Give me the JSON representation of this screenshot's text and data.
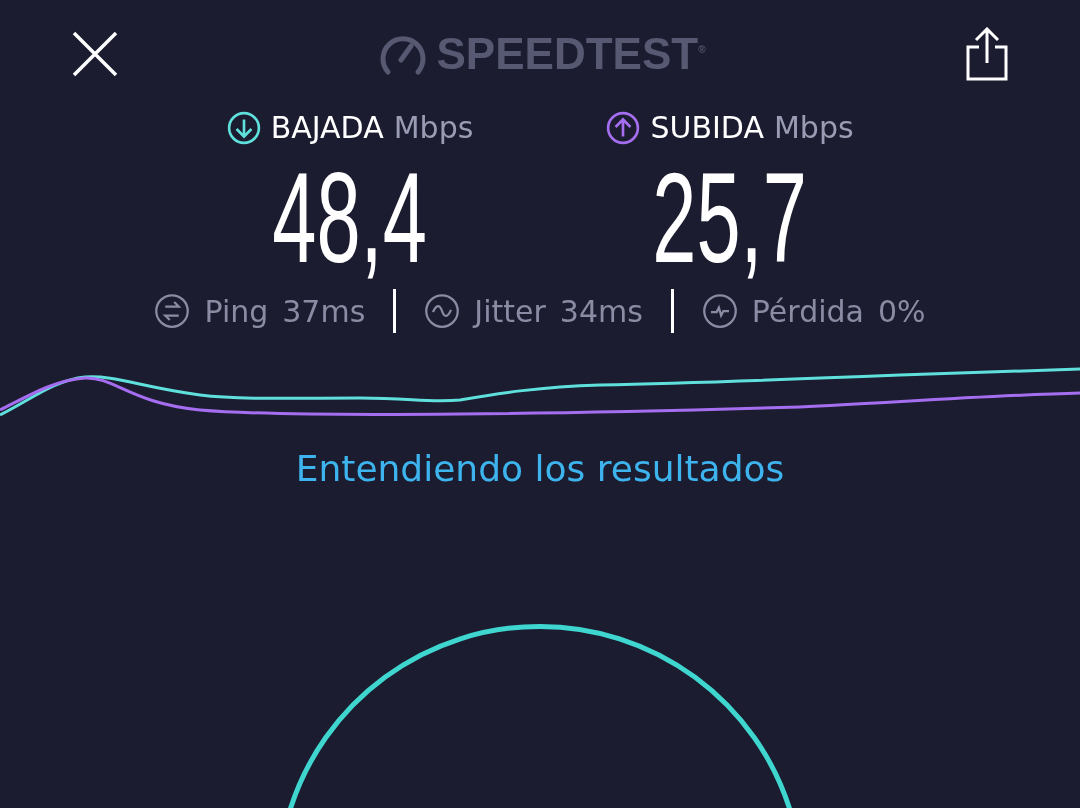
{
  "header": {
    "logo": "SPEEDTEST$^{®}$"
  },
  "results": [
    {
      "kind": "download",
      "label": "BAJADA",
      "unit": "Mbps",
      "value": "48,4"
    },
    {
      "kind": "upload",
      "label": "SUBIDA",
      "unit": "Mbps",
      "value": "25,7"
    }
  ],
  "metrics": [
    {
      "kind": "ping",
      "label": "Ping",
      "value": "37ms"
    },
    {
      "kind": "jitter",
      "label": "Jitter",
      "value": "34ms"
    },
    {
      "kind": "loss",
      "label": "Pérdida",
      "value": "0%"
    }
  ],
  "link": "Entendiendo los resultados"
}
